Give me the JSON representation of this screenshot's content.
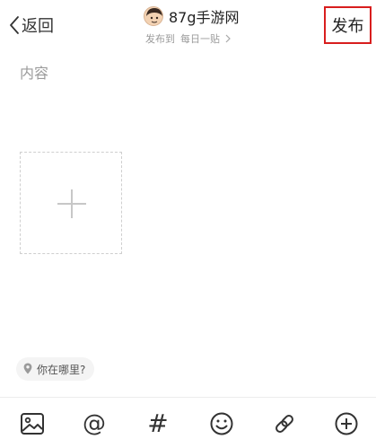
{
  "header": {
    "back_label": "返回",
    "author_name": "87g手游网",
    "forum_prefix": "发布到",
    "forum_name": "每日一贴",
    "publish_label": "发布",
    "publish_highlight_color": "#d81e1e"
  },
  "editor": {
    "content_placeholder": "内容",
    "content_value": ""
  },
  "location": {
    "label": "你在哪里?"
  },
  "toolbar": {
    "items": [
      {
        "icon": "image-icon"
      },
      {
        "icon": "at-icon",
        "glyph": "@"
      },
      {
        "icon": "hashtag-icon",
        "glyph": "#"
      },
      {
        "icon": "emoji-icon"
      },
      {
        "icon": "link-icon"
      },
      {
        "icon": "plus-circle-icon"
      }
    ]
  }
}
